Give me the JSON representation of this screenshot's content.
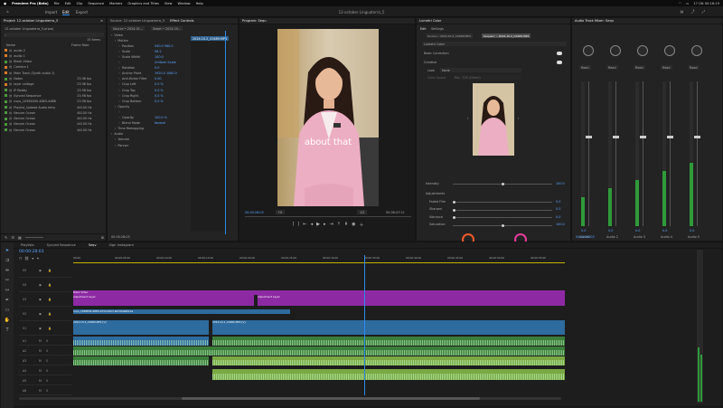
{
  "system": {
    "apple": "",
    "app_name": "Premiere Pro (Beta)",
    "menus": [
      "File",
      "Edit",
      "Clip",
      "Sequence",
      "Markers",
      "Graphics and Titles",
      "View",
      "Window",
      "Help"
    ],
    "clock": "17 Ott 00:16:19"
  },
  "app": {
    "tabs": [
      "Import",
      "Edit",
      "Export"
    ],
    "active_tab": "Edit",
    "document_title": "12-october Linguaterra_5"
  },
  "project": {
    "tab_label": "Project: 12-october Linguaterra_5",
    "file_name": "12-october Linguaterra_5.prproj",
    "item_count": "15 Items",
    "col_name": "Name",
    "col_fps": "Frame Rate",
    "items": [
      {
        "name": "audio 2",
        "fps": "",
        "color": "#d97b2a"
      },
      {
        "name": "audio 1",
        "fps": "",
        "color": "#d97b2a"
      },
      {
        "name": "Black Video",
        "fps": "",
        "color": "#4b9a3d"
      },
      {
        "name": "Camera 1",
        "fps": "",
        "color": "#d97b2a"
      },
      {
        "name": "Main Track (Synth audio 1)",
        "fps": "",
        "color": "#d97b2a"
      },
      {
        "name": "Notes",
        "fps": "23.98 fps",
        "color": "#4b9a3d"
      },
      {
        "name": "layer voltage",
        "fps": "23.98 fps",
        "color": "#d97b2a"
      },
      {
        "name": "IP Bobby",
        "fps": "23.98 fps",
        "color": "#4b9a3d"
      },
      {
        "name": "Synced Sequence",
        "fps": "23.98 fps",
        "color": "#4b9a3d"
      },
      {
        "name": "cups_10384000-4883-4d88",
        "fps": "23.98 fps",
        "color": "#4b9a3d"
      },
      {
        "name": "Playlist_Upbeat Audio Intro",
        "fps": "44100 Hz",
        "color": "#4b9a3d"
      },
      {
        "name": "Nevum Ocean",
        "fps": "44100 Hz",
        "color": "#4b9a3d"
      },
      {
        "name": "Nevum Ocean",
        "fps": "44100 Hz",
        "color": "#4b9a3d"
      },
      {
        "name": "Nevum Ocean",
        "fps": "44100 Hz",
        "color": "#4b9a3d"
      },
      {
        "name": "Nevum Ocean",
        "fps": "44100 Hz",
        "color": "#4b9a3d"
      }
    ]
  },
  "effect_controls": {
    "tab_label": "Effect Controls",
    "source_tab": "Source: 12 october Linguaterra_5",
    "header_source": "Source • 2024-01...",
    "header_seq": "Seqer • 2024-10...",
    "clip_tag": "2024.10.2_C0489.MP4",
    "sections": [
      {
        "label": "Video",
        "indent": 0,
        "value": ""
      },
      {
        "label": "Motion",
        "indent": 1,
        "value": ""
      },
      {
        "label": "Position",
        "indent": 2,
        "value": "540.0   960.0"
      },
      {
        "label": "Scale",
        "indent": 2,
        "value": "58.2"
      },
      {
        "label": "Scale Width",
        "indent": 2,
        "value": "100.0"
      },
      {
        "label": "",
        "indent": 2,
        "value": "Uniform Scale"
      },
      {
        "label": "Rotation",
        "indent": 2,
        "value": "0.0"
      },
      {
        "label": "Anchor Point",
        "indent": 2,
        "value": "1920.0   1080.0"
      },
      {
        "label": "Anti-flicker Filter",
        "indent": 2,
        "value": "0.00"
      },
      {
        "label": "Crop Left",
        "indent": 2,
        "value": "0.0 %"
      },
      {
        "label": "Crop Top",
        "indent": 2,
        "value": "0.0 %"
      },
      {
        "label": "Crop Right",
        "indent": 2,
        "value": "0.0 %"
      },
      {
        "label": "Crop Bottom",
        "indent": 2,
        "value": "0.0 %"
      },
      {
        "label": "Opacity",
        "indent": 1,
        "value": ""
      },
      {
        "label": "",
        "indent": 2,
        "value": ""
      },
      {
        "label": "Opacity",
        "indent": 2,
        "value": "100.0 %"
      },
      {
        "label": "Blend Mode",
        "indent": 2,
        "value": "Normal"
      },
      {
        "label": "Time Remapping",
        "indent": 1,
        "value": ""
      },
      {
        "label": "Audio",
        "indent": 0,
        "value": ""
      },
      {
        "label": "Volume",
        "indent": 1,
        "value": ""
      },
      {
        "label": "Panner",
        "indent": 1,
        "value": ""
      }
    ],
    "timecode": "00:00:28:03"
  },
  "program": {
    "tab_label": "Program: Sequ",
    "caption": "about that",
    "timecode_left": "00:00:28:03",
    "fit": "Fit",
    "quality": "1/2",
    "timecode_right": "00:06:47:12"
  },
  "lumetri": {
    "tab_label": "Lumetri Color",
    "tabs": [
      "Edit",
      "Settings"
    ],
    "source_chip": "Source • 2024.10.2_C0489.MP4",
    "seq_chip": "Sequenc • 2024.10.2_C0489.MP4",
    "effect_name": "Lumetri Color",
    "sections": [
      "Basic Correction",
      "Creative"
    ],
    "look_label": "Look",
    "look_value": "None",
    "colorspace_label": "Color Space",
    "colorspace_value": "Rec. 709 (Direct)",
    "intensity_label": "Intensity",
    "intensity_value": "100.0",
    "adjustments_label": "Adjustments",
    "adjust": [
      {
        "label": "Faded Film",
        "value": "0.0"
      },
      {
        "label": "Sharpen",
        "value": "0.0"
      },
      {
        "label": "Vibrance",
        "value": "0.0"
      },
      {
        "label": "Saturation",
        "value": "100.0"
      }
    ]
  },
  "mixer": {
    "tab_label": "Audio Track Mixer: Sequ",
    "channels": [
      "Audio 1",
      "Audio 2",
      "Audio 3",
      "Audio 4",
      "Audio 5"
    ],
    "db_values": [
      "0.0",
      "0.0",
      "0.0",
      "0.0",
      "0.0"
    ],
    "read_labels": [
      "Read",
      "Read",
      "Read",
      "Read",
      "Read"
    ],
    "timecode": "00:00:28:03"
  },
  "timeline": {
    "tabs": [
      "Playlists",
      "Synced Sequence",
      "Seqv",
      "Sign Instagram"
    ],
    "active_tab": "Seqv",
    "timecode": "00:00:28:03",
    "ruler": [
      "00:00",
      "00:00:05:00",
      "00:00:10:00",
      "00:00:15:00",
      "00:00:20:00",
      "00:00:25:00",
      "00:00:30:00",
      "00:00:35:00",
      "00:00:40:00",
      "00:00:45:00",
      "00:00:50:00",
      "00:00:55:00"
    ],
    "video_tracks": [
      "V5",
      "V4",
      "V3",
      "V2",
      "V1"
    ],
    "audio_tracks": [
      "A1",
      "A2",
      "A3",
      "A4",
      "A5",
      "A6"
    ],
    "clip_labels": {
      "black": "Black Video",
      "adjust": "Adjustment Layer",
      "adjust2": "Adjustment Layer",
      "cups": "cups_1048830-4883-4d3d-b5b3-bbf16da8014a",
      "v1a": "2024.10.2_C0489.MP4 [V]",
      "v1b": "2024.10.2_C0489.MP4 [V]"
    }
  },
  "colors": {
    "accent": "#2d8ceb",
    "purple": "#8d2aa3",
    "blue_clip": "#2e6b9e",
    "green_clip": "#3b7d3a",
    "meter": "#2f9a3a"
  }
}
